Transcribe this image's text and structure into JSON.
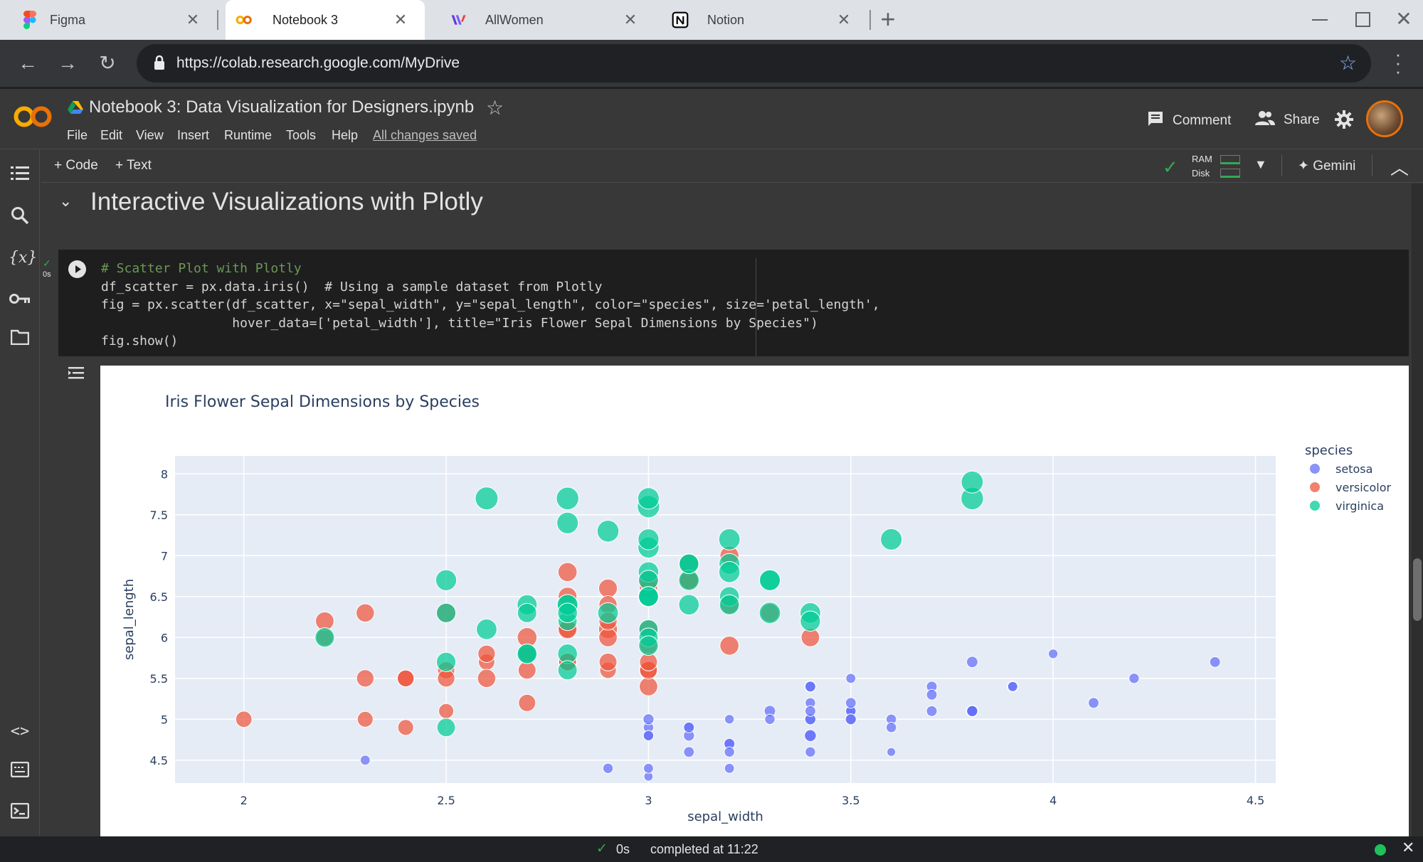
{
  "browser": {
    "tabs": [
      {
        "title": "Figma",
        "active": false,
        "icon": "figma-icon"
      },
      {
        "title": "Notebook 3",
        "active": true,
        "icon": "colab-icon"
      },
      {
        "title": "AllWomen",
        "active": false,
        "icon": "allwomen-icon"
      },
      {
        "title": "Notion",
        "active": false,
        "icon": "notion-icon"
      }
    ],
    "url": "https://colab.research.google.com/MyDrive"
  },
  "colab": {
    "logo": "CO",
    "notebook_title": "Notebook 3: Data Visualization for Designers.ipynb",
    "menu": [
      "File",
      "Edit",
      "View",
      "Insert",
      "Runtime",
      "Tools",
      "Help"
    ],
    "save_status": "All changes saved",
    "comment_label": "Comment",
    "share_label": "Share",
    "toolbar": {
      "add_code": "+ Code",
      "add_text": "+ Text",
      "ram_label": "RAM",
      "disk_label": "Disk",
      "gemini_label": "Gemini"
    },
    "section_title": "Interactive Visualizations with Plotly",
    "cell": {
      "exec_time": "0s",
      "code_lines": [
        "# Scatter Plot with Plotly",
        "df_scatter = px.data.iris()  # Using a sample dataset from Plotly",
        "fig = px.scatter(df_scatter, x=\"sepal_width\", y=\"sepal_length\", color=\"species\", size='petal_length',",
        "                 hover_data=['petal_width'], title=\"Iris Flower Sepal Dimensions by Species\")",
        "fig.show()"
      ]
    },
    "status": {
      "time": "0s",
      "completed": "completed at 11:22"
    }
  },
  "colors": {
    "setosa": "#636efa",
    "versicolor": "#ef553b",
    "virginica": "#00cc96",
    "plot_bg": "#e5ecf6"
  },
  "chart_data": {
    "type": "scatter",
    "title": "Iris Flower Sepal Dimensions by Species",
    "xlabel": "sepal_width",
    "ylabel": "sepal_length",
    "xlim": [
      1.83,
      4.55
    ],
    "ylim": [
      4.22,
      8.22
    ],
    "xticks": [
      2,
      2.5,
      3,
      3.5,
      4,
      4.5
    ],
    "yticks": [
      4.5,
      5,
      5.5,
      6,
      6.5,
      7,
      7.5,
      8
    ],
    "grid": true,
    "legend": {
      "title": "species",
      "position": "top-right"
    },
    "series": [
      {
        "name": "setosa",
        "points": [
          [
            3.5,
            5.1
          ],
          [
            3.0,
            4.9
          ],
          [
            3.2,
            4.7
          ],
          [
            3.1,
            4.6
          ],
          [
            3.6,
            5.0
          ],
          [
            3.9,
            5.4
          ],
          [
            3.4,
            4.6
          ],
          [
            3.4,
            5.0
          ],
          [
            2.9,
            4.4
          ],
          [
            3.1,
            4.9
          ],
          [
            3.7,
            5.4
          ],
          [
            3.4,
            4.8
          ],
          [
            3.0,
            4.8
          ],
          [
            3.0,
            4.3
          ],
          [
            4.0,
            5.8
          ],
          [
            4.4,
            5.7
          ],
          [
            3.9,
            5.4
          ],
          [
            3.5,
            5.1
          ],
          [
            3.8,
            5.7
          ],
          [
            3.8,
            5.1
          ],
          [
            3.4,
            5.4
          ],
          [
            3.7,
            5.1
          ],
          [
            3.6,
            4.6
          ],
          [
            3.3,
            5.1
          ],
          [
            3.4,
            4.8
          ],
          [
            3.0,
            5.0
          ],
          [
            3.4,
            5.0
          ],
          [
            3.5,
            5.2
          ],
          [
            3.4,
            5.2
          ],
          [
            3.2,
            4.7
          ],
          [
            3.1,
            4.8
          ],
          [
            3.4,
            5.4
          ],
          [
            4.1,
            5.2
          ],
          [
            4.2,
            5.5
          ],
          [
            3.1,
            4.9
          ],
          [
            3.2,
            5.0
          ],
          [
            3.5,
            5.5
          ],
          [
            3.6,
            4.9
          ],
          [
            3.0,
            4.4
          ],
          [
            3.4,
            5.1
          ],
          [
            3.5,
            5.0
          ],
          [
            2.3,
            4.5
          ],
          [
            3.2,
            4.4
          ],
          [
            3.5,
            5.0
          ],
          [
            3.8,
            5.1
          ],
          [
            3.0,
            4.8
          ],
          [
            3.8,
            5.1
          ],
          [
            3.2,
            4.6
          ],
          [
            3.7,
            5.3
          ],
          [
            3.3,
            5.0
          ]
        ],
        "sizes": [
          1.4,
          1.4,
          1.3,
          1.5,
          1.4,
          1.7,
          1.4,
          1.5,
          1.4,
          1.5,
          1.5,
          1.6,
          1.4,
          1.1,
          1.2,
          1.5,
          1.3,
          1.4,
          1.7,
          1.5,
          1.7,
          1.5,
          1.0,
          1.7,
          1.9,
          1.6,
          1.6,
          1.5,
          1.4,
          1.6,
          1.6,
          1.5,
          1.5,
          1.4,
          1.5,
          1.2,
          1.3,
          1.4,
          1.3,
          1.5,
          1.3,
          1.3,
          1.3,
          1.6,
          1.9,
          1.4,
          1.6,
          1.4,
          1.5,
          1.4
        ]
      },
      {
        "name": "versicolor",
        "points": [
          [
            3.2,
            7.0
          ],
          [
            3.2,
            6.4
          ],
          [
            3.1,
            6.9
          ],
          [
            2.3,
            5.5
          ],
          [
            2.8,
            6.5
          ],
          [
            2.8,
            5.7
          ],
          [
            3.3,
            6.3
          ],
          [
            2.4,
            4.9
          ],
          [
            2.9,
            6.6
          ],
          [
            2.7,
            5.2
          ],
          [
            2.0,
            5.0
          ],
          [
            3.0,
            5.9
          ],
          [
            2.2,
            6.0
          ],
          [
            2.9,
            6.1
          ],
          [
            2.9,
            5.6
          ],
          [
            3.1,
            6.7
          ],
          [
            3.0,
            5.6
          ],
          [
            2.7,
            5.8
          ],
          [
            2.2,
            6.2
          ],
          [
            2.5,
            5.6
          ],
          [
            3.2,
            5.9
          ],
          [
            2.8,
            6.1
          ],
          [
            2.5,
            6.3
          ],
          [
            2.8,
            6.1
          ],
          [
            2.9,
            6.4
          ],
          [
            3.0,
            6.6
          ],
          [
            2.8,
            6.8
          ],
          [
            3.0,
            6.7
          ],
          [
            2.9,
            6.0
          ],
          [
            2.6,
            5.7
          ],
          [
            2.4,
            5.5
          ],
          [
            2.4,
            5.5
          ],
          [
            2.7,
            5.8
          ],
          [
            2.7,
            6.0
          ],
          [
            3.0,
            5.4
          ],
          [
            3.4,
            6.0
          ],
          [
            3.1,
            6.7
          ],
          [
            2.3,
            6.3
          ],
          [
            3.0,
            5.6
          ],
          [
            2.5,
            5.5
          ],
          [
            2.6,
            5.5
          ],
          [
            3.0,
            6.1
          ],
          [
            2.6,
            5.8
          ],
          [
            2.3,
            5.0
          ],
          [
            2.7,
            5.6
          ],
          [
            3.0,
            5.7
          ],
          [
            2.9,
            5.7
          ],
          [
            2.9,
            6.2
          ],
          [
            2.5,
            5.1
          ],
          [
            2.8,
            5.7
          ]
        ],
        "sizes": [
          4.7,
          4.5,
          4.9,
          4.0,
          4.6,
          4.5,
          4.7,
          3.3,
          4.6,
          3.9,
          3.5,
          4.2,
          4.0,
          4.7,
          3.6,
          4.4,
          4.5,
          4.1,
          4.5,
          3.9,
          4.8,
          4.0,
          4.9,
          4.7,
          4.3,
          4.4,
          4.8,
          5.0,
          4.5,
          3.5,
          3.8,
          3.7,
          3.9,
          5.1,
          4.5,
          4.5,
          4.7,
          4.4,
          4.1,
          4.0,
          4.4,
          4.6,
          4.0,
          3.3,
          4.2,
          4.2,
          4.2,
          4.3,
          3.0,
          4.1
        ]
      },
      {
        "name": "virginica",
        "points": [
          [
            3.3,
            6.3
          ],
          [
            2.7,
            5.8
          ],
          [
            3.0,
            7.1
          ],
          [
            2.9,
            6.3
          ],
          [
            3.0,
            6.5
          ],
          [
            3.0,
            7.6
          ],
          [
            2.5,
            4.9
          ],
          [
            2.9,
            7.3
          ],
          [
            2.5,
            6.7
          ],
          [
            3.6,
            7.2
          ],
          [
            3.2,
            6.5
          ],
          [
            2.7,
            6.4
          ],
          [
            3.0,
            6.8
          ],
          [
            2.5,
            5.7
          ],
          [
            2.8,
            5.8
          ],
          [
            3.2,
            6.4
          ],
          [
            3.0,
            6.5
          ],
          [
            3.8,
            7.7
          ],
          [
            2.6,
            7.7
          ],
          [
            2.2,
            6.0
          ],
          [
            3.2,
            6.9
          ],
          [
            2.8,
            5.6
          ],
          [
            2.8,
            7.7
          ],
          [
            2.7,
            6.3
          ],
          [
            3.3,
            6.7
          ],
          [
            3.2,
            7.2
          ],
          [
            2.8,
            6.2
          ],
          [
            3.0,
            6.1
          ],
          [
            2.8,
            6.4
          ],
          [
            3.0,
            7.2
          ],
          [
            2.8,
            7.4
          ],
          [
            3.8,
            7.9
          ],
          [
            2.8,
            6.4
          ],
          [
            2.8,
            6.3
          ],
          [
            2.6,
            6.1
          ],
          [
            3.0,
            7.7
          ],
          [
            3.4,
            6.3
          ],
          [
            3.1,
            6.4
          ],
          [
            3.0,
            6.0
          ],
          [
            3.1,
            6.9
          ],
          [
            3.1,
            6.7
          ],
          [
            3.1,
            6.9
          ],
          [
            2.7,
            5.8
          ],
          [
            3.2,
            6.8
          ],
          [
            3.3,
            6.7
          ],
          [
            3.0,
            6.7
          ],
          [
            2.5,
            6.3
          ],
          [
            3.0,
            6.5
          ],
          [
            3.4,
            6.2
          ],
          [
            3.0,
            5.9
          ]
        ],
        "sizes": [
          6.0,
          5.1,
          5.9,
          5.6,
          5.8,
          6.6,
          4.5,
          6.3,
          5.8,
          6.1,
          5.1,
          5.3,
          5.5,
          5.0,
          5.1,
          5.3,
          5.5,
          6.7,
          6.9,
          5.0,
          5.7,
          4.9,
          6.7,
          4.9,
          5.7,
          6.0,
          4.8,
          4.9,
          5.6,
          5.8,
          6.1,
          6.4,
          5.6,
          5.1,
          5.6,
          6.1,
          5.6,
          5.5,
          4.8,
          5.4,
          5.6,
          5.1,
          5.1,
          5.9,
          5.7,
          5.2,
          5.0,
          5.2,
          5.4,
          5.1
        ]
      }
    ]
  }
}
